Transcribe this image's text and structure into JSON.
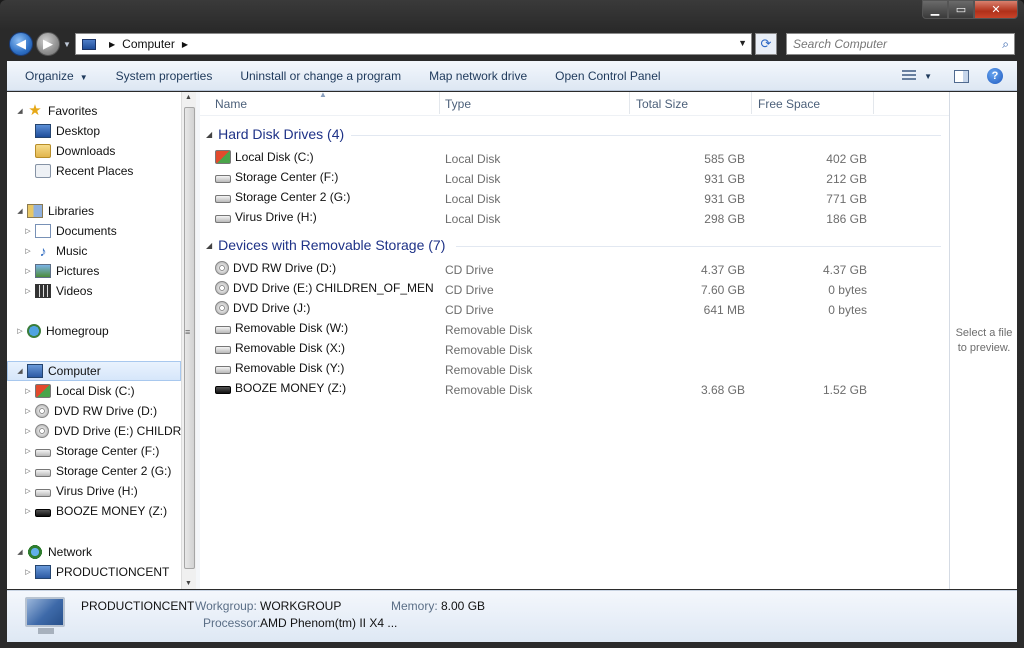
{
  "window": {
    "minimize_glyph": "▁",
    "maximize_glyph": "▭",
    "close_glyph": "✕"
  },
  "address": {
    "crumb": "Computer",
    "separator": "▶",
    "search_placeholder": "Search Computer"
  },
  "toolbar": {
    "organize": "Organize",
    "system_properties": "System properties",
    "uninstall": "Uninstall or change a program",
    "map_drive": "Map network drive",
    "control_panel": "Open Control Panel"
  },
  "nav": {
    "favorites": "Favorites",
    "desktop": "Desktop",
    "downloads": "Downloads",
    "recent": "Recent Places",
    "libraries": "Libraries",
    "documents": "Documents",
    "music": "Music",
    "pictures": "Pictures",
    "videos": "Videos",
    "homegroup": "Homegroup",
    "computer": "Computer",
    "drives": [
      "Local Disk (C:)",
      "DVD RW Drive (D:)",
      "DVD Drive (E:) CHILDREN_OF_MEN",
      "Storage Center (F:)",
      "Storage Center 2 (G:)",
      "Virus Drive (H:)",
      "BOOZE MONEY (Z:)"
    ],
    "network": "Network",
    "network_pc": "PRODUCTIONCENT"
  },
  "columns": {
    "name": "Name",
    "type": "Type",
    "total": "Total Size",
    "free": "Free Space"
  },
  "groups": {
    "hdd": "Hard Disk Drives (4)",
    "removable": "Devices with Removable Storage (7)"
  },
  "hdd": [
    {
      "name": "Local Disk (C:)",
      "type": "Local Disk",
      "total": "585 GB",
      "free": "402 GB",
      "icon": "windows-drive-icon"
    },
    {
      "name": "Storage Center (F:)",
      "type": "Local Disk",
      "total": "931 GB",
      "free": "212 GB",
      "icon": "hard-drive-icon"
    },
    {
      "name": "Storage Center 2 (G:)",
      "type": "Local Disk",
      "total": "931 GB",
      "free": "771 GB",
      "icon": "hard-drive-icon"
    },
    {
      "name": "Virus Drive (H:)",
      "type": "Local Disk",
      "total": "298 GB",
      "free": "186 GB",
      "icon": "hard-drive-icon"
    }
  ],
  "removable": [
    {
      "name": "DVD RW Drive (D:)",
      "type": "CD Drive",
      "total": "4.37 GB",
      "free": "4.37 GB",
      "icon": "dvd-icon"
    },
    {
      "name": "DVD Drive (E:) CHILDREN_OF_MEN",
      "type": "CD Drive",
      "total": "7.60 GB",
      "free": "0 bytes",
      "icon": "dvd-icon"
    },
    {
      "name": "DVD Drive (J:)",
      "type": "CD Drive",
      "total": "641 MB",
      "free": "0 bytes",
      "icon": "dvd-icon"
    },
    {
      "name": "Removable Disk (W:)",
      "type": "Removable Disk",
      "total": "",
      "free": "",
      "icon": "removable-drive-icon"
    },
    {
      "name": "Removable Disk (X:)",
      "type": "Removable Disk",
      "total": "",
      "free": "",
      "icon": "removable-drive-icon"
    },
    {
      "name": "Removable Disk (Y:)",
      "type": "Removable Disk",
      "total": "",
      "free": "",
      "icon": "removable-drive-icon"
    },
    {
      "name": "BOOZE MONEY (Z:)",
      "type": "Removable Disk",
      "total": "3.68 GB",
      "free": "1.52 GB",
      "icon": "usb-drive-icon"
    }
  ],
  "preview": {
    "message": "Select a file to preview."
  },
  "details": {
    "computer_name": "PRODUCTIONCENT",
    "workgroup_label": "Workgroup:",
    "workgroup": "WORKGROUP",
    "memory_label": "Memory:",
    "memory": "8.00 GB",
    "processor_label": "Processor:",
    "processor": "AMD Phenom(tm) II X4 ..."
  },
  "colors": {
    "group_heading": "#1e3287",
    "command_text": "#1e395b",
    "selection": "#d6e6fa"
  }
}
